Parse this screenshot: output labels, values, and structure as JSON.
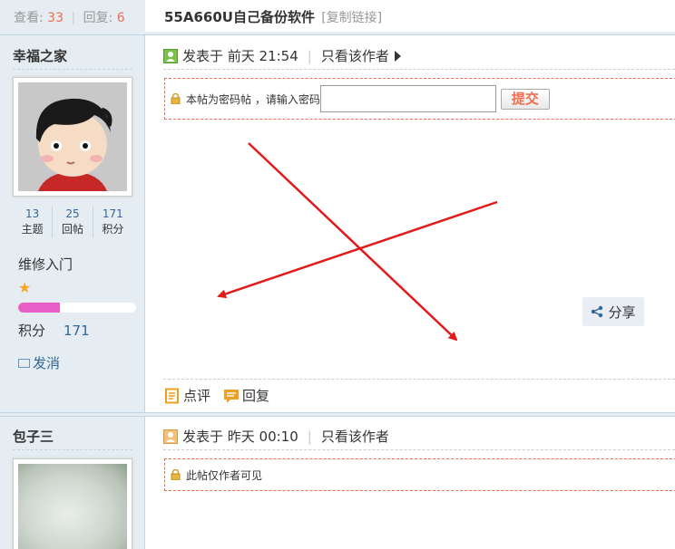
{
  "topbar": {
    "views_label": "查看:",
    "views_value": "33",
    "replies_label": "回复:",
    "replies_value": "6",
    "thread_title": "55A660U自己备份软件",
    "copy_link": "[复制链接]"
  },
  "posts": [
    {
      "author": "幸福之家",
      "stats": [
        {
          "value": "13",
          "label": "主题"
        },
        {
          "value": "25",
          "label": "回帖"
        },
        {
          "value": "171",
          "label": "积分"
        }
      ],
      "rank": "维修入门",
      "level_progress": 0.35,
      "points_label": "积分",
      "points_value": "171",
      "send_msg": "发消",
      "posted_label": "发表于 前天 21:54",
      "only_author": "只看该作者",
      "locked_text": "本帖为密码帖 ，请输入密码",
      "submit_label": "提交",
      "share_label": "分享",
      "comment_label": "点评",
      "reply_label": "回复"
    },
    {
      "author": "包子三",
      "posted_label": "发表于 昨天 00:10",
      "only_author": "只看该作者",
      "locked_text": "此帖仅作者可见"
    }
  ],
  "colors": {
    "sidebar_bg": "#e5edf2",
    "accent_red": "#f26c4f",
    "link_blue": "#336699",
    "progress_pink": "#e75fc6"
  }
}
